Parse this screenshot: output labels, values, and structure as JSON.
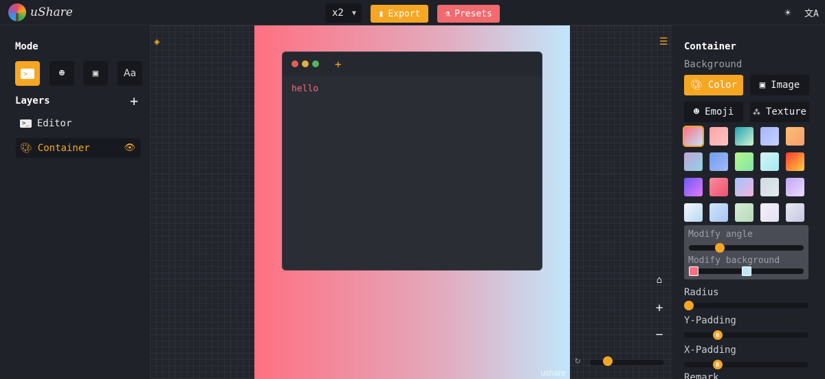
{
  "app": {
    "brand": "uShare"
  },
  "topbar": {
    "scale": "x2",
    "export_label": "Export",
    "presets_label": "Presets",
    "theme_icon": "sun-icon",
    "language_icon": "translate-icon"
  },
  "left": {
    "mode_title": "Mode",
    "modes": [
      {
        "name": "terminal",
        "icon": "terminal-icon",
        "glyph": ">_"
      },
      {
        "name": "emoji",
        "icon": "emoji-icon",
        "glyph": "☻"
      },
      {
        "name": "image",
        "icon": "image-icon",
        "glyph": "▣"
      },
      {
        "name": "text",
        "icon": "text-icon",
        "glyph": "Aa"
      }
    ],
    "active_mode": "terminal",
    "layers_title": "Layers",
    "layers": [
      {
        "label": "Editor",
        "icon": "terminal-icon",
        "active": false
      },
      {
        "label": "Container",
        "icon": "palette-icon",
        "active": true,
        "visible": true
      }
    ]
  },
  "canvas": {
    "editor_text": "hello",
    "watermark": "ushare",
    "dot_colors": [
      "#e05f55",
      "#e0b03e",
      "#52b45a"
    ],
    "gradient_colors": [
      "#ff7082",
      "#c1e6fb"
    ],
    "zoom_level": 0.2
  },
  "right": {
    "title": "Container",
    "background_label": "Background",
    "bg_types": [
      {
        "label": "Color",
        "icon": "palette-icon",
        "active": true
      },
      {
        "label": "Image",
        "icon": "image-icon",
        "active": false
      },
      {
        "label": "Emoji",
        "icon": "emoji-icon",
        "active": false
      },
      {
        "label": "Texture",
        "icon": "texture-icon",
        "active": false
      }
    ],
    "swatches": [
      [
        "#ff7082",
        "#c1e6fb"
      ],
      [
        "#ffa3a6",
        "#ffc5c1"
      ],
      [
        "#1fa2b5",
        "#d7f6d0"
      ],
      [
        "#a5b4fc",
        "#c7d2fe"
      ],
      [
        "#fbbf77",
        "#f59e6b"
      ],
      [
        "#c1a4d4",
        "#8fd3e8"
      ],
      [
        "#6f9ef0",
        "#a4b8f6"
      ],
      [
        "#b6f58a",
        "#83e6a8"
      ],
      [
        "#d3f5f6",
        "#a6e9f0"
      ],
      [
        "#ff3a2d",
        "#ffd23f"
      ],
      [
        "#6a5af9",
        "#e879f9"
      ],
      [
        "#fa8c9e",
        "#f0506e"
      ],
      [
        "#a0c4ff",
        "#f7b3d9"
      ],
      [
        "#cfd9df",
        "#e2ebf0"
      ],
      [
        "#c3a6f5",
        "#eadcff"
      ],
      [
        "#f5f7fa",
        "#b4d9f5"
      ],
      [
        "#cfe3ff",
        "#a8c6f3"
      ],
      [
        "#d5ecd4",
        "#b7d9b8"
      ],
      [
        "#f3f0fa",
        "#e4e0f2"
      ],
      [
        "#e6e9f0",
        "#c9c6e4"
      ]
    ],
    "selected_swatch": 0,
    "modify_angle_label": "Modify angle",
    "modify_angle_value": 0.25,
    "modify_background_label": "Modify background",
    "modify_background_stops": [
      0.0,
      0.5
    ],
    "radius_label": "Radius",
    "radius_value": 0.0,
    "ypadding_label": "Y-Padding",
    "ypadding_knob": "B",
    "ypadding_value": 0.25,
    "xpadding_label": "X-Padding",
    "xpadding_knob": "R",
    "xpadding_value": 0.25,
    "next_label": "Remark"
  }
}
